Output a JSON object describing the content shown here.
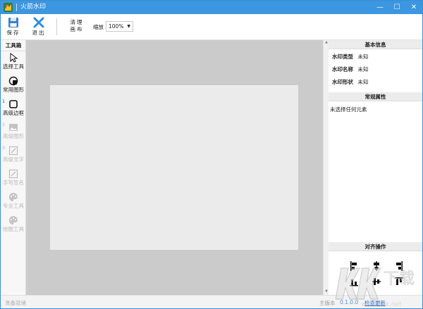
{
  "titlebar": {
    "title": "火箭水印",
    "minimize": "—",
    "maximize": "☐",
    "close": "✕"
  },
  "toolbar": {
    "save_label": "保存",
    "exit_label": "退出",
    "clear_label_line1": "清理",
    "clear_label_line2": "画布",
    "zoom_label": "缩放",
    "zoom_value": "100%"
  },
  "toolbox": {
    "title": "工具箱",
    "tools": [
      {
        "label": "选择工具",
        "icon": "cursor-icon",
        "enabled": true
      },
      {
        "label": "常用图形",
        "icon": "shapes-icon",
        "enabled": true
      },
      {
        "label": "高级边框",
        "icon": "border-icon",
        "enabled": true,
        "num": "1"
      },
      {
        "label": "高级图形",
        "icon": "image-icon",
        "enabled": false,
        "num": "2"
      },
      {
        "label": "高级文字",
        "icon": "text-edit-icon",
        "enabled": false,
        "num": "3"
      },
      {
        "label": "手写签名",
        "icon": "signature-icon",
        "enabled": false
      },
      {
        "label": "专业工具",
        "icon": "palette-icon",
        "enabled": false
      },
      {
        "label": "绘图工具",
        "icon": "palette-icon",
        "enabled": false
      }
    ]
  },
  "panel": {
    "basic_title": "基本信息",
    "rows": [
      {
        "key": "水印类型",
        "value": "未知"
      },
      {
        "key": "水印名称",
        "value": "未知"
      },
      {
        "key": "水印形状",
        "value": "未知"
      }
    ],
    "props_title": "常规属性",
    "no_selection": "未选择任何元素",
    "align_title": "对齐操作"
  },
  "statusbar": {
    "left": "准备就绪",
    "version_label": "主版本",
    "version": "0.1.0.0",
    "update": "检查更新"
  },
  "colors": {
    "titlebar": "#3c96e0",
    "canvas_bg": "#cbcbcb",
    "page": "#ebebeb",
    "accent": "#2a6fcc"
  }
}
